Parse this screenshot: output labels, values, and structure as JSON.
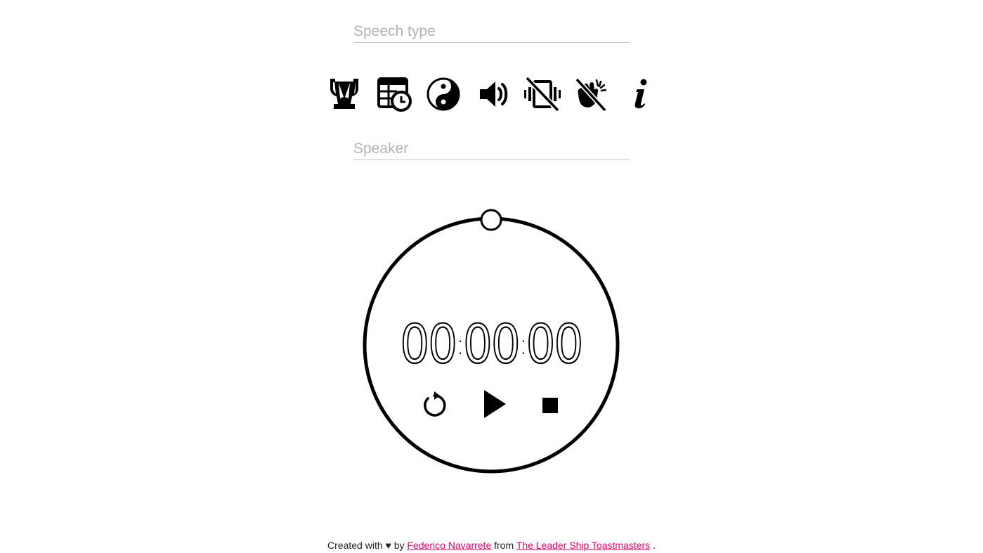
{
  "inputs": {
    "speech_type": {
      "value": "",
      "placeholder": "Speech type"
    },
    "speaker": {
      "value": "",
      "placeholder": "Speaker"
    }
  },
  "toolbar": {
    "items": [
      {
        "icon": "trophy-icon"
      },
      {
        "icon": "schedule-table-icon"
      },
      {
        "icon": "yin-yang-icon"
      },
      {
        "icon": "volume-icon"
      },
      {
        "icon": "vibrate-off-icon"
      },
      {
        "icon": "clap-off-icon"
      },
      {
        "icon": "info-icon"
      }
    ]
  },
  "timer": {
    "hours": "00",
    "minutes": "00",
    "seconds": "00",
    "separator": ":",
    "progress": 0
  },
  "controls": {
    "reset_icon": "reset-icon",
    "play_icon": "play-icon",
    "stop_icon": "stop-icon"
  },
  "footer": {
    "prefix": "Created with ♥ by",
    "author": "Federico Navarrete",
    "middle": "from",
    "club": "The Leader Ship Toastmasters",
    "suffix": "."
  },
  "colors": {
    "link": "#e4006a",
    "placeholder": "#b3b3b3",
    "ring": "#000000"
  }
}
